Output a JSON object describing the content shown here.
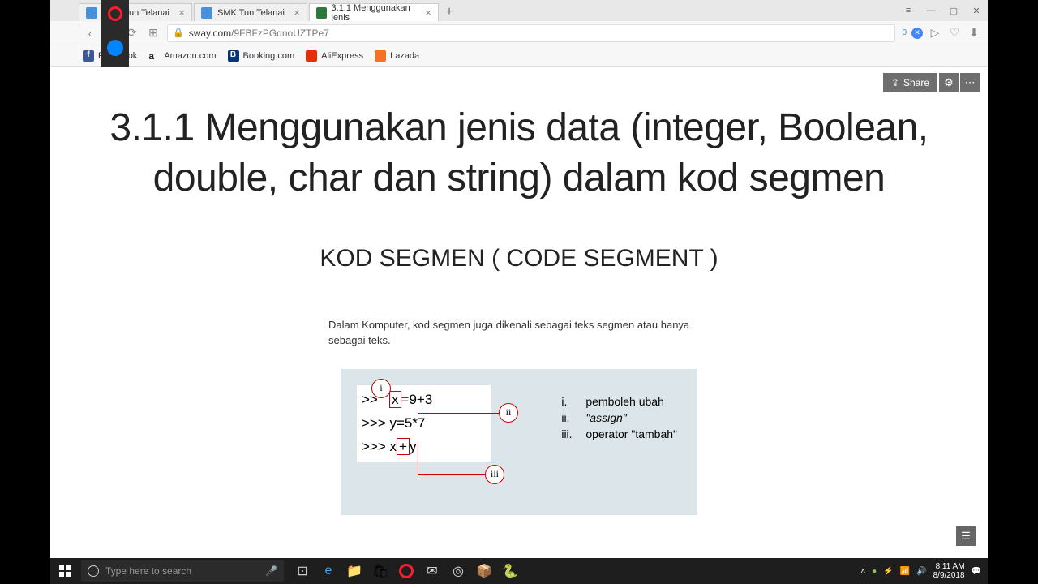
{
  "tabs": [
    {
      "title": "SMK Tun Telanai",
      "active": false
    },
    {
      "title": "SMK Tun Telanai",
      "active": false
    },
    {
      "title": "3.1.1 Menggunakan jenis",
      "active": true
    }
  ],
  "url": {
    "domain": "sway.com",
    "path": "/9FBFzPGdnoUZTPe7"
  },
  "url_badge": "0",
  "bookmarks": [
    {
      "label": "Facebook",
      "color": "#3b5998"
    },
    {
      "label": "Amazon.com",
      "color": "#222"
    },
    {
      "label": "Booking.com",
      "color": "#003580"
    },
    {
      "label": "AliExpress",
      "color": "#e62e04"
    },
    {
      "label": "Lazada",
      "color": "#f57224"
    }
  ],
  "share": {
    "label": "Share"
  },
  "page": {
    "title": "3.1.1 Menggunakan jenis data (integer, Boolean, double, char dan string) dalam kod segmen",
    "subtitle": "KOD SEGMEN ( CODE SEGMENT )",
    "body": "Dalam Komputer, kod segmen juga dikenali sebagai teks segmen atau hanya sebagai teks."
  },
  "code": {
    "line1_pre": ">>",
    "line1_var": "x",
    "line1_rest": "=9+3",
    "line2": ">>> y=5*7",
    "line3_pre": ">>> x",
    "line3_op": "+",
    "line3_post": "y",
    "label_i": "i",
    "label_ii": "ii",
    "label_iii": "iii"
  },
  "legend": [
    {
      "num": "i.",
      "text": "pemboleh ubah"
    },
    {
      "num": "ii.",
      "text": "\"assign\""
    },
    {
      "num": "iii.",
      "text": "operator \"tambah\""
    }
  ],
  "taskbar": {
    "search_placeholder": "Type here to search"
  },
  "systray": {
    "time": "8:11 AM",
    "date": "8/9/2018"
  }
}
